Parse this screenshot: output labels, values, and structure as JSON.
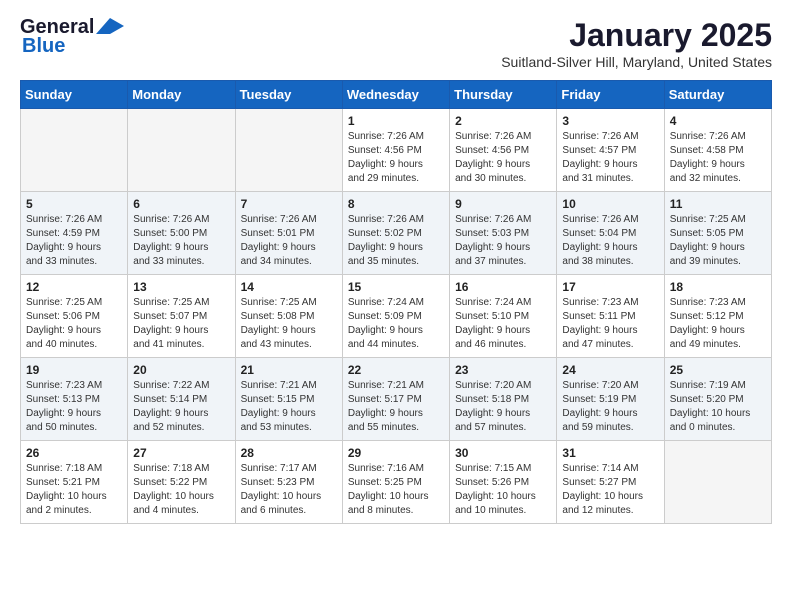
{
  "logo": {
    "line1": "General",
    "line2": "Blue"
  },
  "title": "January 2025",
  "subtitle": "Suitland-Silver Hill, Maryland, United States",
  "days_of_week": [
    "Sunday",
    "Monday",
    "Tuesday",
    "Wednesday",
    "Thursday",
    "Friday",
    "Saturday"
  ],
  "weeks": [
    [
      {
        "num": "",
        "info": ""
      },
      {
        "num": "",
        "info": ""
      },
      {
        "num": "",
        "info": ""
      },
      {
        "num": "1",
        "info": "Sunrise: 7:26 AM\nSunset: 4:56 PM\nDaylight: 9 hours\nand 29 minutes."
      },
      {
        "num": "2",
        "info": "Sunrise: 7:26 AM\nSunset: 4:56 PM\nDaylight: 9 hours\nand 30 minutes."
      },
      {
        "num": "3",
        "info": "Sunrise: 7:26 AM\nSunset: 4:57 PM\nDaylight: 9 hours\nand 31 minutes."
      },
      {
        "num": "4",
        "info": "Sunrise: 7:26 AM\nSunset: 4:58 PM\nDaylight: 9 hours\nand 32 minutes."
      }
    ],
    [
      {
        "num": "5",
        "info": "Sunrise: 7:26 AM\nSunset: 4:59 PM\nDaylight: 9 hours\nand 33 minutes."
      },
      {
        "num": "6",
        "info": "Sunrise: 7:26 AM\nSunset: 5:00 PM\nDaylight: 9 hours\nand 33 minutes."
      },
      {
        "num": "7",
        "info": "Sunrise: 7:26 AM\nSunset: 5:01 PM\nDaylight: 9 hours\nand 34 minutes."
      },
      {
        "num": "8",
        "info": "Sunrise: 7:26 AM\nSunset: 5:02 PM\nDaylight: 9 hours\nand 35 minutes."
      },
      {
        "num": "9",
        "info": "Sunrise: 7:26 AM\nSunset: 5:03 PM\nDaylight: 9 hours\nand 37 minutes."
      },
      {
        "num": "10",
        "info": "Sunrise: 7:26 AM\nSunset: 5:04 PM\nDaylight: 9 hours\nand 38 minutes."
      },
      {
        "num": "11",
        "info": "Sunrise: 7:25 AM\nSunset: 5:05 PM\nDaylight: 9 hours\nand 39 minutes."
      }
    ],
    [
      {
        "num": "12",
        "info": "Sunrise: 7:25 AM\nSunset: 5:06 PM\nDaylight: 9 hours\nand 40 minutes."
      },
      {
        "num": "13",
        "info": "Sunrise: 7:25 AM\nSunset: 5:07 PM\nDaylight: 9 hours\nand 41 minutes."
      },
      {
        "num": "14",
        "info": "Sunrise: 7:25 AM\nSunset: 5:08 PM\nDaylight: 9 hours\nand 43 minutes."
      },
      {
        "num": "15",
        "info": "Sunrise: 7:24 AM\nSunset: 5:09 PM\nDaylight: 9 hours\nand 44 minutes."
      },
      {
        "num": "16",
        "info": "Sunrise: 7:24 AM\nSunset: 5:10 PM\nDaylight: 9 hours\nand 46 minutes."
      },
      {
        "num": "17",
        "info": "Sunrise: 7:23 AM\nSunset: 5:11 PM\nDaylight: 9 hours\nand 47 minutes."
      },
      {
        "num": "18",
        "info": "Sunrise: 7:23 AM\nSunset: 5:12 PM\nDaylight: 9 hours\nand 49 minutes."
      }
    ],
    [
      {
        "num": "19",
        "info": "Sunrise: 7:23 AM\nSunset: 5:13 PM\nDaylight: 9 hours\nand 50 minutes."
      },
      {
        "num": "20",
        "info": "Sunrise: 7:22 AM\nSunset: 5:14 PM\nDaylight: 9 hours\nand 52 minutes."
      },
      {
        "num": "21",
        "info": "Sunrise: 7:21 AM\nSunset: 5:15 PM\nDaylight: 9 hours\nand 53 minutes."
      },
      {
        "num": "22",
        "info": "Sunrise: 7:21 AM\nSunset: 5:17 PM\nDaylight: 9 hours\nand 55 minutes."
      },
      {
        "num": "23",
        "info": "Sunrise: 7:20 AM\nSunset: 5:18 PM\nDaylight: 9 hours\nand 57 minutes."
      },
      {
        "num": "24",
        "info": "Sunrise: 7:20 AM\nSunset: 5:19 PM\nDaylight: 9 hours\nand 59 minutes."
      },
      {
        "num": "25",
        "info": "Sunrise: 7:19 AM\nSunset: 5:20 PM\nDaylight: 10 hours\nand 0 minutes."
      }
    ],
    [
      {
        "num": "26",
        "info": "Sunrise: 7:18 AM\nSunset: 5:21 PM\nDaylight: 10 hours\nand 2 minutes."
      },
      {
        "num": "27",
        "info": "Sunrise: 7:18 AM\nSunset: 5:22 PM\nDaylight: 10 hours\nand 4 minutes."
      },
      {
        "num": "28",
        "info": "Sunrise: 7:17 AM\nSunset: 5:23 PM\nDaylight: 10 hours\nand 6 minutes."
      },
      {
        "num": "29",
        "info": "Sunrise: 7:16 AM\nSunset: 5:25 PM\nDaylight: 10 hours\nand 8 minutes."
      },
      {
        "num": "30",
        "info": "Sunrise: 7:15 AM\nSunset: 5:26 PM\nDaylight: 10 hours\nand 10 minutes."
      },
      {
        "num": "31",
        "info": "Sunrise: 7:14 AM\nSunset: 5:27 PM\nDaylight: 10 hours\nand 12 minutes."
      },
      {
        "num": "",
        "info": ""
      }
    ]
  ]
}
